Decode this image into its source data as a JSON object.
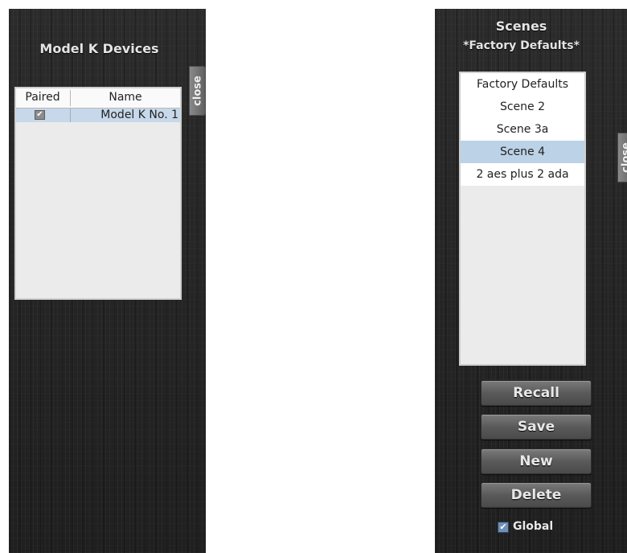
{
  "devices_panel": {
    "title": "Model K Devices",
    "close_label": "close",
    "columns": [
      "Paired",
      "Name"
    ],
    "rows": [
      {
        "paired": true,
        "check_glyph": "✔",
        "name": "Model K No. 1"
      }
    ]
  },
  "scenes_panel": {
    "title": "Scenes",
    "current_scene": "*Factory Defaults*",
    "close_label": "close",
    "items": [
      "Factory Defaults",
      "Scene 2",
      "Scene 3a",
      "Scene 4",
      "2 aes plus 2 ada"
    ],
    "selected_index": 3,
    "buttons": {
      "recall": "Recall",
      "save": "Save",
      "new": "New",
      "delete": "Delete"
    },
    "global_checkbox": {
      "label": "Global",
      "checked": true,
      "glyph": "✔"
    }
  },
  "colors": {
    "panel_bg": "#242424",
    "selection": "#bcd2e6",
    "global_check": "#6f8fb8"
  }
}
